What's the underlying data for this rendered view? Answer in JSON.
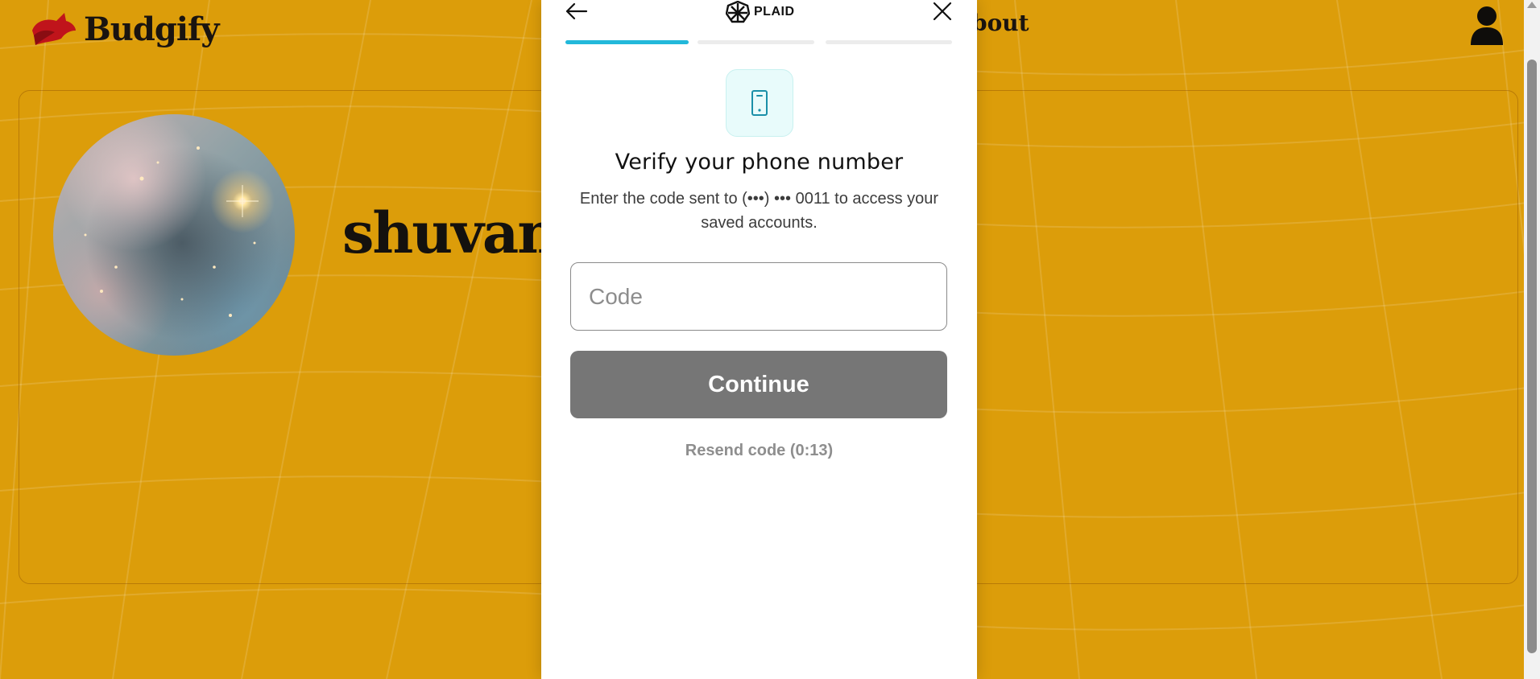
{
  "app": {
    "brand_name": "Budgify",
    "nav_about": "bout",
    "colors": {
      "background": "#dc9d0a",
      "text_dark": "#14110e",
      "logo_red": "#c0141b"
    }
  },
  "profile": {
    "username": "shuvam"
  },
  "plaid_modal": {
    "brand_label": "PLAID",
    "back_icon": "arrow-left-icon",
    "close_icon": "close-icon",
    "steps": [
      {
        "state": "active"
      },
      {
        "state": "inactive"
      },
      {
        "state": "inactive"
      }
    ],
    "icon": "phone-icon",
    "title": "Verify your phone number",
    "description": "Enter the code sent to (•••) ••• 0011 to access your saved accounts.",
    "code_input": {
      "placeholder": "Code",
      "value": ""
    },
    "continue_label": "Continue",
    "resend_label": "Resend code (0:13)",
    "colors": {
      "progress_active": "#22b8da",
      "button_disabled": "#767676",
      "icon_accent": "#1a8fa8"
    }
  }
}
